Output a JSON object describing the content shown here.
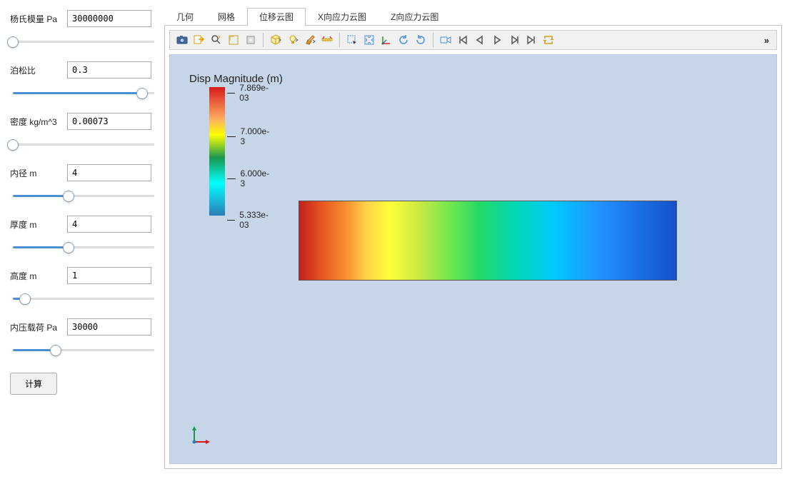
{
  "params": {
    "youngs_modulus": {
      "label": "杨氏模量 Pa",
      "value": "30000000",
      "slider_percent": 2
    },
    "poisson": {
      "label": "泊松比",
      "value": "0.3",
      "slider_percent": 90
    },
    "density": {
      "label": "密度 kg/m^3",
      "value": "0.00073",
      "slider_percent": 2
    },
    "inner_radius": {
      "label": "内径 m",
      "value": "4",
      "slider_percent": 40
    },
    "thickness": {
      "label": "厚度 m",
      "value": "4",
      "slider_percent": 40
    },
    "height": {
      "label": "高度 m",
      "value": "1",
      "slider_percent": 10
    },
    "pressure": {
      "label": "内压载荷 Pa",
      "value": "30000",
      "slider_percent": 31
    }
  },
  "calc_button": "计算",
  "tabs": [
    "几何",
    "网格",
    "位移云图",
    "X向应力云图",
    "Z向应力云图"
  ],
  "active_tab": 2,
  "toolbar_icons": [
    "camera-icon",
    "export-icon",
    "zoom-icon",
    "ruler-box-icon",
    "projection-icon",
    "sep",
    "cube-view-icon",
    "lightbulb-icon",
    "brush-icon",
    "caliper-icon",
    "sep",
    "select-icon",
    "fit-icon",
    "axes-icon",
    "rotate-cw-icon",
    "rotate-ccw-icon",
    "sep",
    "video-icon",
    "first-frame-icon",
    "prev-frame-icon",
    "play-icon",
    "next-frame-icon",
    "last-frame-icon",
    "loop-icon"
  ],
  "overflow_symbol": "»",
  "legend": {
    "title": "Disp Magnitude (m)",
    "ticks": [
      {
        "pos": 0,
        "label": "7.869e-03"
      },
      {
        "pos": 34,
        "label": "7.000e-3"
      },
      {
        "pos": 67,
        "label": "6.000e-3"
      },
      {
        "pos": 100,
        "label": "5.333e-03"
      }
    ]
  }
}
